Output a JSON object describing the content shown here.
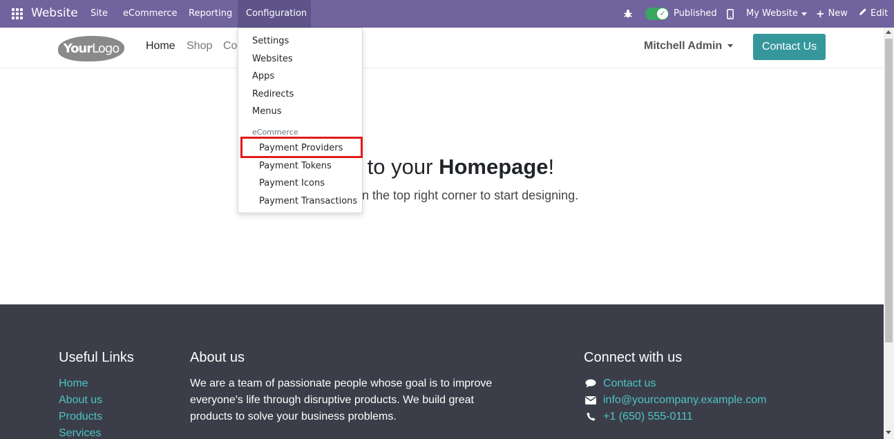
{
  "topbar": {
    "brand": "Website",
    "menus": [
      "Site",
      "eCommerce",
      "Reporting",
      "Configuration"
    ],
    "published_label": "Published",
    "website_label": "My Website",
    "new_label": "New",
    "edit_label": "Edit",
    "bar_color": "#71639e"
  },
  "header": {
    "logo_your": "Your",
    "logo_logo": "Logo",
    "nav": [
      "Home",
      "Shop",
      "Co"
    ],
    "user": "Mitchell Admin",
    "contact_button": "Contact Us",
    "accent_color": "#35979c"
  },
  "dropdown": {
    "items": [
      "Settings",
      "Websites",
      "Apps",
      "Redirects",
      "Menus"
    ],
    "section_header": "eCommerce",
    "section_items": [
      "Payment Providers",
      "Payment Tokens",
      "Payment Icons",
      "Payment Transactions"
    ],
    "highlighted": "Payment Providers"
  },
  "hero": {
    "title_prefix": "me to your ",
    "title_bold": "Homepage",
    "title_suffix": "!",
    "subtitle": "t in the top right corner to start designing."
  },
  "footer": {
    "useful_links_title": "Useful Links",
    "useful_links": [
      "Home",
      "About us",
      "Products",
      "Services"
    ],
    "about_title": "About us",
    "about_text": "We are a team of passionate people whose goal is to improve everyone's life through disruptive products. We build great products to solve your business problems.",
    "connect_title": "Connect with us",
    "connect_items": [
      {
        "icon": "comment-icon",
        "text": "Contact us"
      },
      {
        "icon": "envelope-icon",
        "text": "info@yourcompany.example.com"
      },
      {
        "icon": "phone-icon",
        "text": "+1 (650) 555-0111"
      }
    ],
    "link_color": "#4fc3c9"
  }
}
